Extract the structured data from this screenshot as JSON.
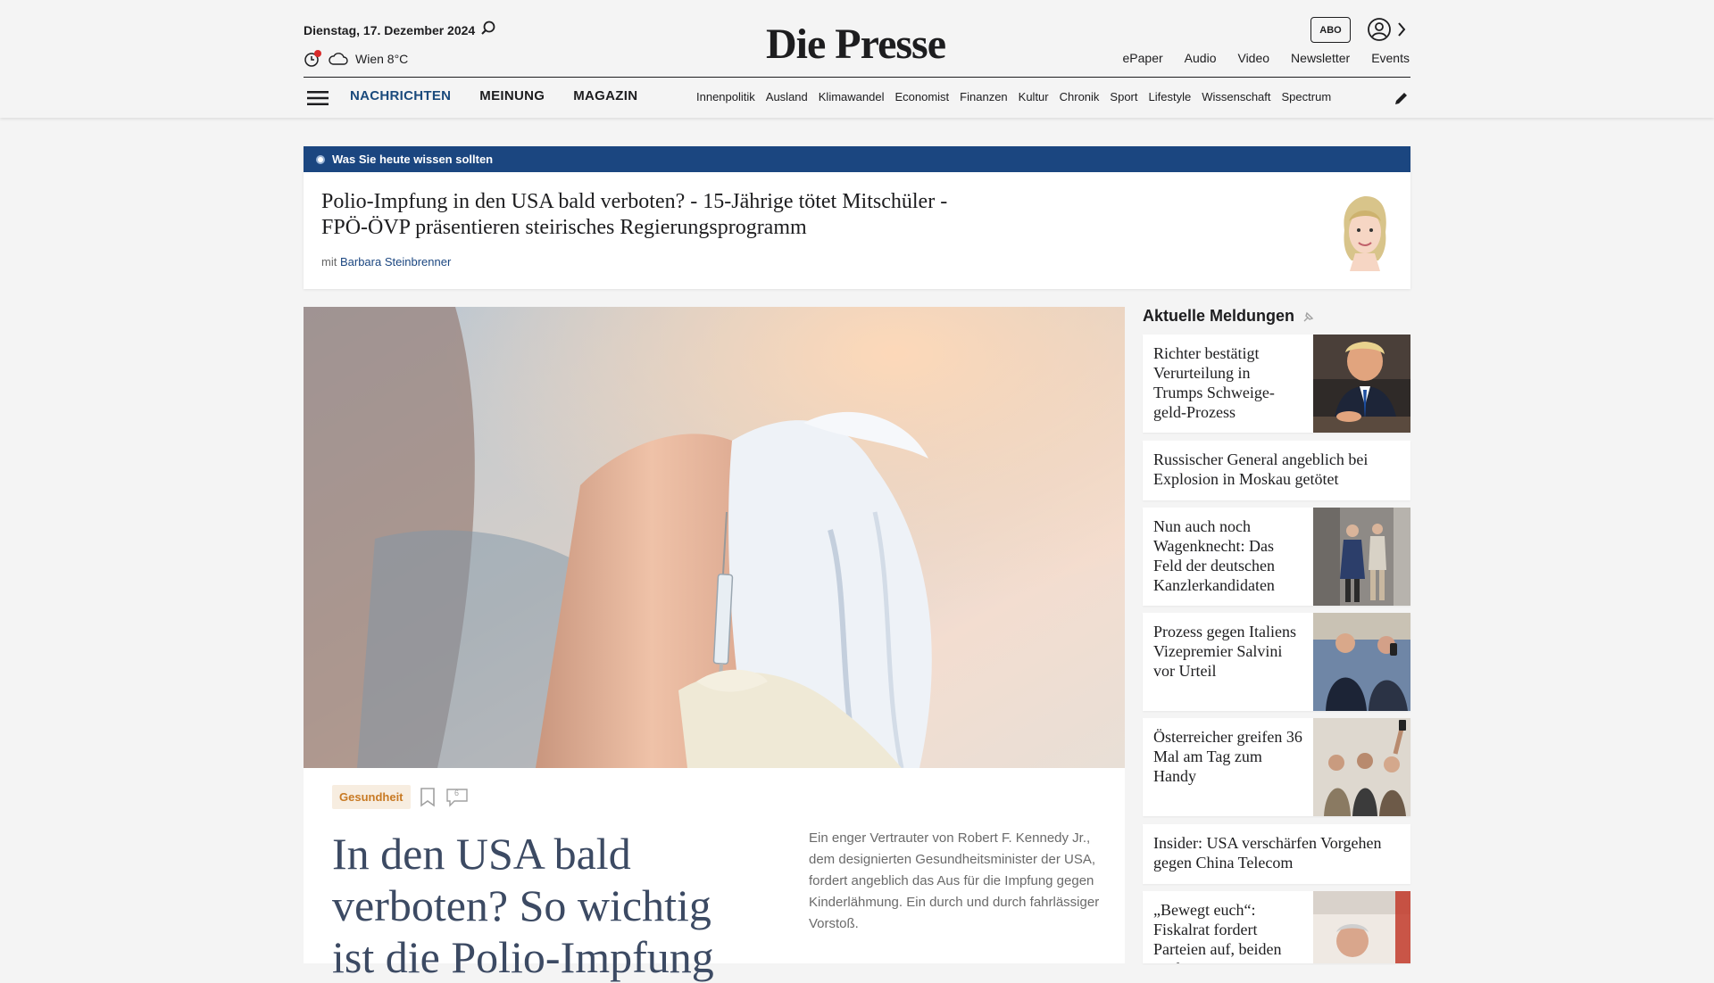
{
  "header": {
    "date": "Dienstag, 17. Dezember 2024",
    "weather": "Wien 8°C",
    "logo": "Die Presse",
    "abo_label": "ABO",
    "top_links": [
      "ePaper",
      "Audio",
      "Video",
      "Newsletter",
      "Events"
    ],
    "main_nav": [
      "NACHRICHTEN",
      "MEINUNG",
      "MAGAZIN"
    ],
    "sub_nav": [
      "Innenpolitik",
      "Ausland",
      "Klimawandel",
      "Economist",
      "Finanzen",
      "Kultur",
      "Chronik",
      "Sport",
      "Lifestyle",
      "Wissenschaft",
      "Spectrum"
    ]
  },
  "banner": {
    "label": "Was Sie heute wissen sollten",
    "title": "Polio-Impfung in den USA bald verboten? - 15-Jährige tötet Mitschüler - FPÖ-ÖVP präsentieren steirisches Regierungsprogramm",
    "author_prefix": "mit",
    "author": "Barbara Steinbrenner"
  },
  "hero": {
    "tag": "Gesundheit",
    "comments": "6",
    "title": "In den USA bald verboten? So wichtig ist die Polio-Impfung",
    "teaser": "Ein enger Vertrauter von Robert F. Kennedy Jr., dem designierten Gesundheitsminister der USA, fordert angeblich das Aus für die Impfung gegen Kinderlähmung. Ein durch und durch fahrlässiger Vorstoß."
  },
  "sidebar": {
    "title": "Aktuelle Meldungen",
    "items": [
      {
        "title": "Richter bestätigt Verurteilung in Trumps Schweige-geld-Prozess"
      },
      {
        "title": "Russischer General angeblich bei Explosion in Moskau getötet"
      },
      {
        "title": "Nun auch noch Wagenknecht: Das Feld der deutschen Kanzlerkandidaten"
      },
      {
        "title": "Prozess gegen Italiens Vizepremier Salvini vor Urteil"
      },
      {
        "title": "Österreicher greifen 36 Mal am Tag zum Handy"
      },
      {
        "title": "Insider: USA verschärfen Vorgehen gegen China Telecom"
      },
      {
        "title": "„Bewegt euch“: Fiskalrat fordert Parteien auf, beiden Budget…"
      }
    ]
  },
  "colors": {
    "brand_blue": "#1b4680",
    "nav_blue": "#1a4a7c",
    "tag_orange": "#c87a24"
  }
}
